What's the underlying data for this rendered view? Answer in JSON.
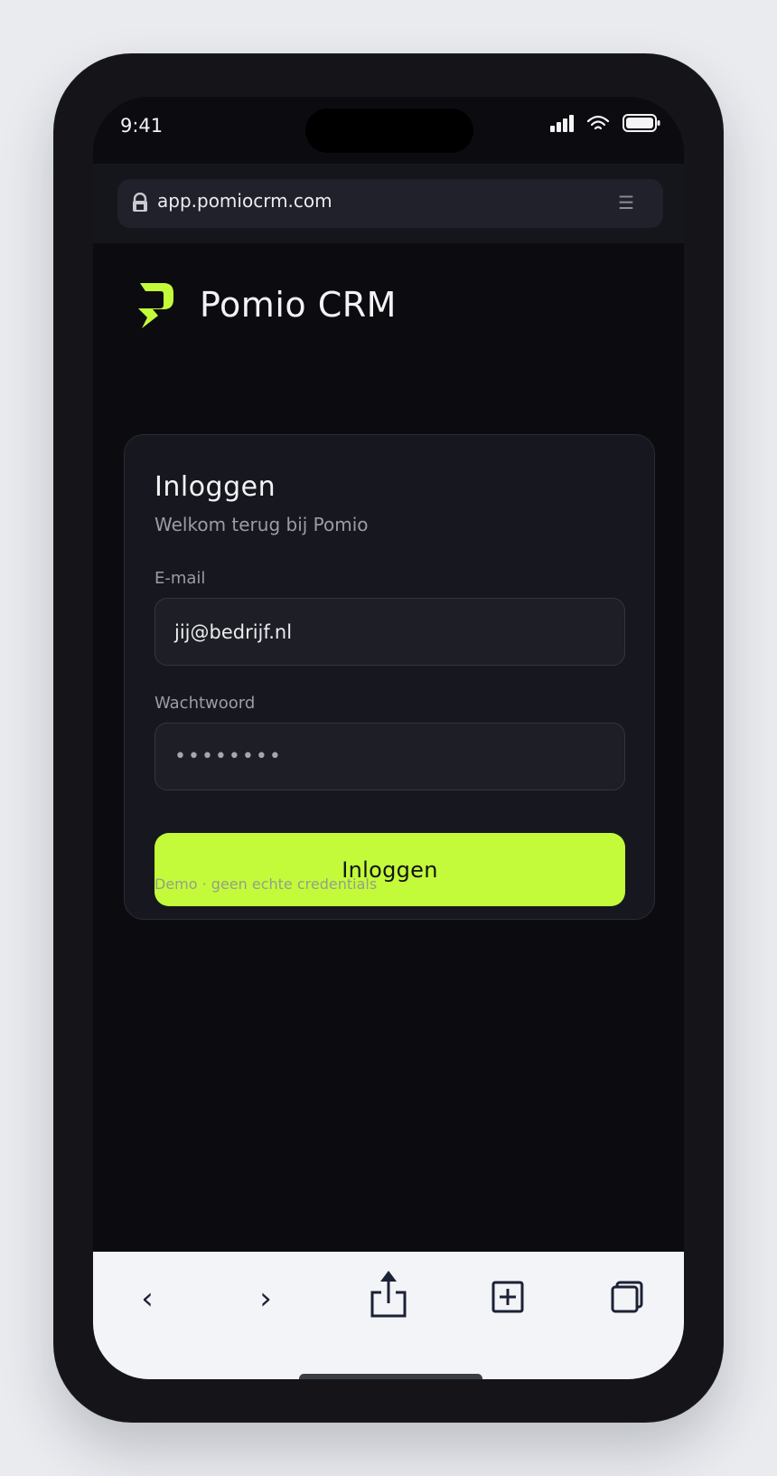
{
  "status_bar": {
    "time": "9:41",
    "icons": [
      "signal-icon",
      "wifi-icon",
      "battery-icon"
    ]
  },
  "browser": {
    "url": "app.pomiocrm.com",
    "icons": [
      "lock-icon",
      "menu-icon"
    ],
    "menu_glyph": "☰",
    "toolbar": {
      "back_glyph": "‹",
      "forward_glyph": "›",
      "icons": [
        "back-icon",
        "forward-icon",
        "share-icon",
        "new-tab-icon",
        "tabs-icon"
      ]
    }
  },
  "brand": {
    "name": "Pomio CRM",
    "accent_color": "#c3fb3a"
  },
  "login": {
    "title": "Inloggen",
    "subtitle": "Welkom terug bij Pomio",
    "email_label": "E-mail",
    "email_value": "jij@bedrijf.nl",
    "password_label": "Wachtwoord",
    "password_value": "••••••••",
    "submit_label": "Inloggen",
    "note": "Demo · geen echte credentials"
  }
}
